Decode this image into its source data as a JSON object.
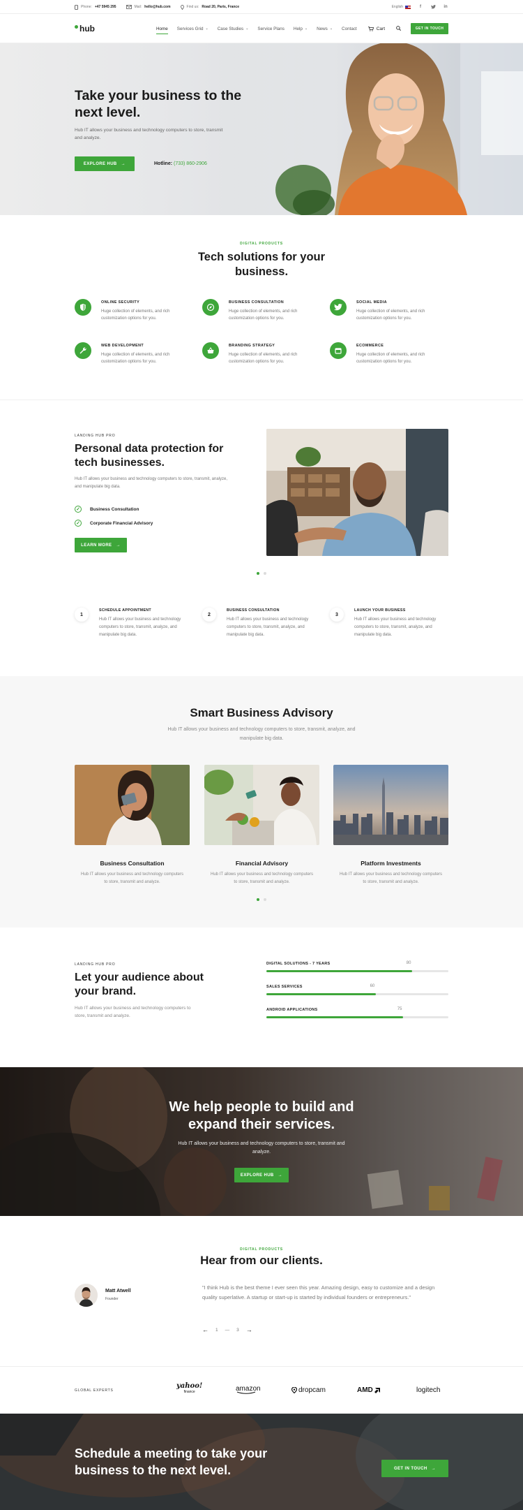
{
  "topbar": {
    "phone_label": "Phone:",
    "phone_value": "+47 5945 295",
    "mail_label": "Mail:",
    "mail_value": "hello@hub.com",
    "address_label": "Find us:",
    "address_value": "Road 20, Paris, France",
    "language": "English",
    "social_icons": [
      "facebook-icon",
      "twitter-icon",
      "linkedin-icon"
    ]
  },
  "nav": {
    "logo_text": "hub",
    "items": [
      {
        "label": "Home",
        "dropdown": false,
        "active": true
      },
      {
        "label": "Services Grid",
        "dropdown": true
      },
      {
        "label": "Case Studies",
        "dropdown": true
      },
      {
        "label": "Service Plans",
        "dropdown": false
      },
      {
        "label": "Help",
        "dropdown": true
      },
      {
        "label": "News",
        "dropdown": true
      },
      {
        "label": "Contact",
        "dropdown": false
      }
    ],
    "cart_label": "Cart",
    "cta_label": "Get in touch"
  },
  "hero": {
    "title": "Take your business to the next level.",
    "text": "Hub IT allows your business and technology computers to store, transmit and analyze.",
    "button_label": "Explore Hub",
    "hotline_label": "Hotline:",
    "hotline_value": "(733) 860-2906"
  },
  "tech": {
    "eyebrow": "Digital products",
    "title": "Tech solutions for your business.",
    "features": [
      {
        "title": "Online security",
        "text": "Huge collection of elements, and rich customization options for you.",
        "icon": "shield-icon"
      },
      {
        "title": "Business consultation",
        "text": "Huge collection of elements, and rich customization options for you.",
        "icon": "compass-icon"
      },
      {
        "title": "Social media",
        "text": "Huge collection of elements, and rich customization options for you.",
        "icon": "twitter-icon"
      },
      {
        "title": "Web development",
        "text": "Huge collection of elements, and rich customization options for you.",
        "icon": "wrench-icon"
      },
      {
        "title": "Branding strategy",
        "text": "Huge collection of elements, and rich customization options for you.",
        "icon": "basket-icon"
      },
      {
        "title": "Ecommerce",
        "text": "Huge collection of elements, and rich customization options for you.",
        "icon": "storefront-icon"
      }
    ]
  },
  "personal": {
    "eyebrow": "Landing Hub Pro",
    "title": "Personal data protection for tech businesses.",
    "text": "Hub IT allows your business and technology computers to store, transmit, analyze, and manipulate big data.",
    "checks": [
      "Business Consultation",
      "Corporate Financial Advisory"
    ],
    "button_label": "Learn more"
  },
  "steps": [
    {
      "num": "1",
      "title": "Schedule appointment",
      "text": "Hub IT allows your business and technology computers to store, transmit, analyze, and manipulate big data."
    },
    {
      "num": "2",
      "title": "Business consultation",
      "text": "Hub IT allows your business and technology computers to store, transmit, analyze, and manipulate big data."
    },
    {
      "num": "3",
      "title": "Launch your business",
      "text": "Hub IT allows your business and technology computers to store, transmit, analyze, and manipulate big data."
    }
  ],
  "advisory": {
    "title": "Smart Business Advisory",
    "text": "Hub IT allows your business and technology computers to store, transmit, analyze, and manipulate big data.",
    "cards": [
      {
        "title": "Business Consultation",
        "text": "Hub IT allows your business and technology computers to store, transmit and analyze."
      },
      {
        "title": "Financial Advisory",
        "text": "Hub IT allows your business and technology computers to store, transmit and analyze."
      },
      {
        "title": "Platform Investments",
        "text": "Hub IT allows your business and technology computers to store, transmit and analyze."
      }
    ]
  },
  "audience": {
    "eyebrow": "Landing Hub Pro",
    "title": "Let your audience about your brand.",
    "text": "Hub IT allows your business and technology computers to store, transmit and analyze.",
    "bars": [
      {
        "label": "Digital solutions - 7 years",
        "value": 80,
        "value_text": "80"
      },
      {
        "label": "Sales services",
        "value": 60,
        "value_text": "60"
      },
      {
        "label": "Android applications",
        "value": 75,
        "value_text": "75"
      }
    ]
  },
  "cta": {
    "title": "We help people to build and expand their services.",
    "text": "Hub IT allows your business and technology computers to store, transmit and analyze.",
    "button_label": "Explore Hub"
  },
  "clients": {
    "eyebrow": "Digital products",
    "title": "Hear from our clients.",
    "name": "Matt Atwell",
    "role": "Founder",
    "quote": "\"I think Hub is the best theme I ever seen this year. Amazing design, easy to customize and a design quality superlative. A startup or start-up is started by individual founders or entrepreneurs.\"",
    "page_current": "1",
    "page_sep": "—",
    "page_total": "3"
  },
  "logos": {
    "label": "Global experts",
    "brands": [
      "yahoo!",
      "finance",
      "amazon",
      "dropcam",
      "AMD",
      "logitech"
    ]
  },
  "meeting": {
    "title": "Schedule a meeting to take your business to the next level.",
    "button_label": "Get in touch"
  },
  "colors": {
    "accent": "#3ea63a",
    "text": "#1b1b1b",
    "muted": "#777777"
  }
}
